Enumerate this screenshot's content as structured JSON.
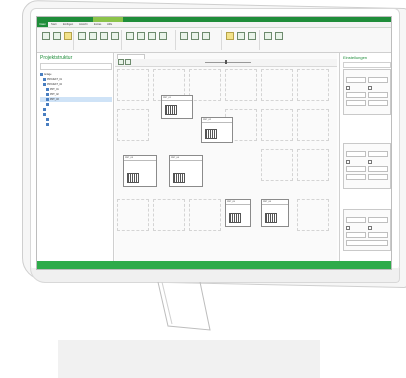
{
  "app": {
    "accent": "#1f8d3a",
    "contextual_accent": "#8bc34a",
    "title": "",
    "tabs": [
      "Datei",
      "Start",
      "Einfügen",
      "Ansicht",
      "Extras",
      "Hilfe"
    ]
  },
  "ribbon": {
    "groups": [
      {
        "name": "",
        "items": [
          "",
          ""
        ]
      },
      {
        "name": "",
        "items": [
          "",
          ""
        ]
      },
      {
        "name": "",
        "items": [
          "",
          "",
          ""
        ]
      },
      {
        "name": "",
        "items": [
          "",
          ""
        ]
      },
      {
        "name": "",
        "items": [
          "",
          ""
        ]
      },
      {
        "name": "",
        "items": [
          "",
          ""
        ]
      }
    ]
  },
  "left_panel": {
    "title": "Projektstruktur",
    "tree": [
      {
        "label": "Anlage",
        "level": 0
      },
      {
        "label": "PROJEKT_01",
        "level": 1
      },
      {
        "label": "PROJEKT_02",
        "level": 1
      },
      {
        "label": "PRT_01",
        "level": 2
      },
      {
        "label": "PRT_02",
        "level": 2
      },
      {
        "label": "PRT_03",
        "level": 2
      },
      {
        "label": "",
        "level": 2
      },
      {
        "label": "",
        "level": 1
      },
      {
        "label": "",
        "level": 1
      },
      {
        "label": "",
        "level": 2
      },
      {
        "label": "",
        "level": 2
      }
    ]
  },
  "canvas": {
    "doc_tab": "",
    "nodes": [
      {
        "title": "PRT_01"
      },
      {
        "title": "PRT_02"
      },
      {
        "title": "PRT_03"
      },
      {
        "title": "PRT_04"
      },
      {
        "title": "PRT_05"
      },
      {
        "title": "PRT_06"
      }
    ]
  },
  "right_panel": {
    "title": "Einstellungen",
    "sections": [
      "",
      "",
      ""
    ]
  }
}
